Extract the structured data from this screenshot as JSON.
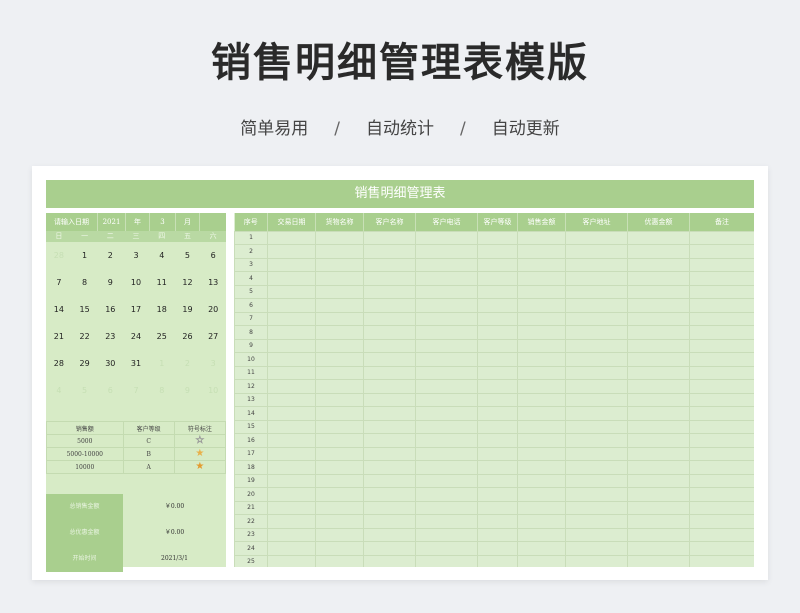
{
  "page": {
    "title": "销售明细管理表模版",
    "subtitle": [
      "简单易用",
      "自动统计",
      "自动更新"
    ],
    "separator": "/"
  },
  "sheet": {
    "banner": "销售明细管理表",
    "datebar": {
      "label": "请输入日期",
      "year": "2021",
      "year_unit": "年",
      "month": "3",
      "month_unit": "月"
    },
    "weekdays": [
      "日",
      "一",
      "二",
      "三",
      "四",
      "五",
      "六"
    ],
    "calendar": [
      [
        "28",
        "1",
        "2",
        "3",
        "4",
        "5",
        "6"
      ],
      [
        "7",
        "8",
        "9",
        "10",
        "11",
        "12",
        "13"
      ],
      [
        "14",
        "15",
        "16",
        "17",
        "18",
        "19",
        "20"
      ],
      [
        "21",
        "22",
        "23",
        "24",
        "25",
        "26",
        "27"
      ],
      [
        "28",
        "29",
        "30",
        "31",
        "1",
        "2",
        "3"
      ],
      [
        "4",
        "5",
        "6",
        "7",
        "8",
        "9",
        "10"
      ]
    ],
    "legend": {
      "headers": [
        "销售额",
        "客户等级",
        "符号标注"
      ],
      "rows": [
        {
          "amount": "5000",
          "level": "C",
          "star": "☆"
        },
        {
          "amount": "5000-10000",
          "level": "B",
          "star": "★"
        },
        {
          "amount": "10000",
          "level": "A",
          "star": "★"
        }
      ],
      "star_colors": [
        "#ffffff",
        "#e8b04a",
        "#e39b2f"
      ]
    },
    "summary": [
      {
        "label": "总销售金额",
        "value": "￥0.00"
      },
      {
        "label": "总优惠金额",
        "value": "￥0.00"
      },
      {
        "label": "开始时间",
        "value": "2021/3/1"
      }
    ],
    "columns": [
      "序号",
      "交易日期",
      "货物名称",
      "客户名称",
      "客户电话",
      "客户等级",
      "销售金额",
      "客户地址",
      "优惠金额",
      "备注"
    ],
    "row_numbers": [
      "1",
      "2",
      "3",
      "4",
      "5",
      "6",
      "7",
      "8",
      "9",
      "10",
      "11",
      "12",
      "13",
      "14",
      "15",
      "16",
      "17",
      "18",
      "19",
      "20",
      "21",
      "22",
      "23",
      "24",
      "25"
    ]
  },
  "colors": {
    "accent": "#a9cf8e",
    "panel": "#d7ebc6",
    "grid": "#dcedd0"
  }
}
